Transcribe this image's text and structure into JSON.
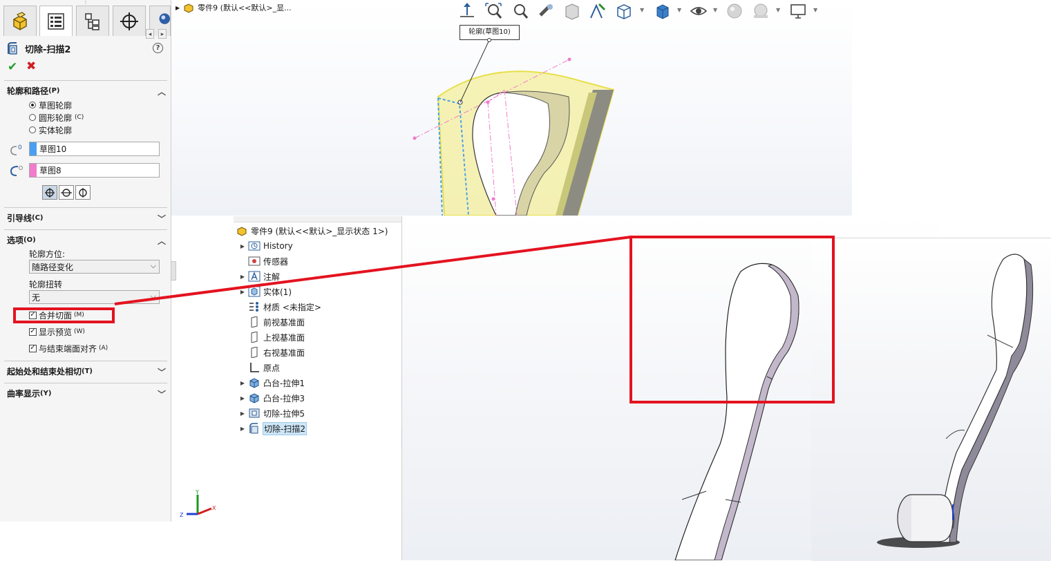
{
  "property_manager": {
    "feature_title": "切除-扫描2",
    "help_symbol": "?",
    "ok_symbol": "✔",
    "cancel_symbol": "✖",
    "tab_scroll_left": "◂",
    "tab_scroll_right": "▸",
    "profile_path": {
      "title": "轮廓和路径",
      "hotkey": "(P)",
      "options": [
        {
          "label": "草图轮廓",
          "hotkey": "",
          "selected": true
        },
        {
          "label": "圆形轮廓",
          "hotkey": "(C)",
          "selected": false
        },
        {
          "label": "实体轮廓",
          "hotkey": "",
          "selected": false
        }
      ],
      "profile_value": "草图10",
      "path_value": "草图8",
      "profile_color": "#4a9ff0",
      "path_color": "#f07ccb"
    },
    "guide_curves": {
      "title": "引导线",
      "hotkey": "(C)"
    },
    "options": {
      "title": "选项",
      "hotkey": "(O)",
      "orientation_label": "轮廓方位:",
      "orientation_value": "随路径变化",
      "twist_label": "轮廓扭转",
      "twist_value": "无",
      "checkboxes": [
        {
          "label": "合并切面",
          "hotkey": "(M)",
          "checked": true
        },
        {
          "label": "显示预览",
          "hotkey": "(W)",
          "checked": true
        },
        {
          "label": "与结束端面对齐",
          "hotkey": "(A)",
          "checked": true
        }
      ]
    },
    "tangency": {
      "title": "起始处和结束处相切",
      "hotkey": "(T)"
    },
    "curvature": {
      "title": "曲率显示",
      "hotkey": "(Y)"
    }
  },
  "viewport_top": {
    "breadcrumb": "零件9  (默认<<默认>_显...",
    "callout_label": "轮廓(草图10)"
  },
  "axis_triad": {
    "x": "X",
    "y": "Y",
    "z": "Z"
  },
  "feature_tree": {
    "root": "零件9  (默认<<默认>_显示状态 1>)",
    "items": [
      {
        "label": "History",
        "icon": "history-icon",
        "expandable": true,
        "selected": false
      },
      {
        "label": "传感器",
        "icon": "sensor-icon",
        "expandable": false,
        "selected": false
      },
      {
        "label": "注解",
        "icon": "annotation-icon",
        "expandable": true,
        "selected": false
      },
      {
        "label": "实体(1)",
        "icon": "solid-bodies-icon",
        "expandable": true,
        "selected": false
      },
      {
        "label": "材质 <未指定>",
        "icon": "material-icon",
        "expandable": false,
        "selected": false
      },
      {
        "label": "前视基准面",
        "icon": "plane-icon",
        "expandable": false,
        "selected": false
      },
      {
        "label": "上视基准面",
        "icon": "plane-icon",
        "expandable": false,
        "selected": false
      },
      {
        "label": "右视基准面",
        "icon": "plane-icon",
        "expandable": false,
        "selected": false
      },
      {
        "label": "原点",
        "icon": "origin-icon",
        "expandable": false,
        "selected": false
      },
      {
        "label": "凸台-拉伸1",
        "icon": "boss-extrude-icon",
        "expandable": true,
        "selected": false
      },
      {
        "label": "凸台-拉伸3",
        "icon": "boss-extrude-icon",
        "expandable": true,
        "selected": false
      },
      {
        "label": "切除-拉伸5",
        "icon": "cut-extrude-icon",
        "expandable": true,
        "selected": false
      },
      {
        "label": "切除-扫描2",
        "icon": "cut-sweep-icon",
        "expandable": true,
        "selected": true
      }
    ]
  },
  "annotation": {
    "highlight_color": "#e3131f"
  }
}
